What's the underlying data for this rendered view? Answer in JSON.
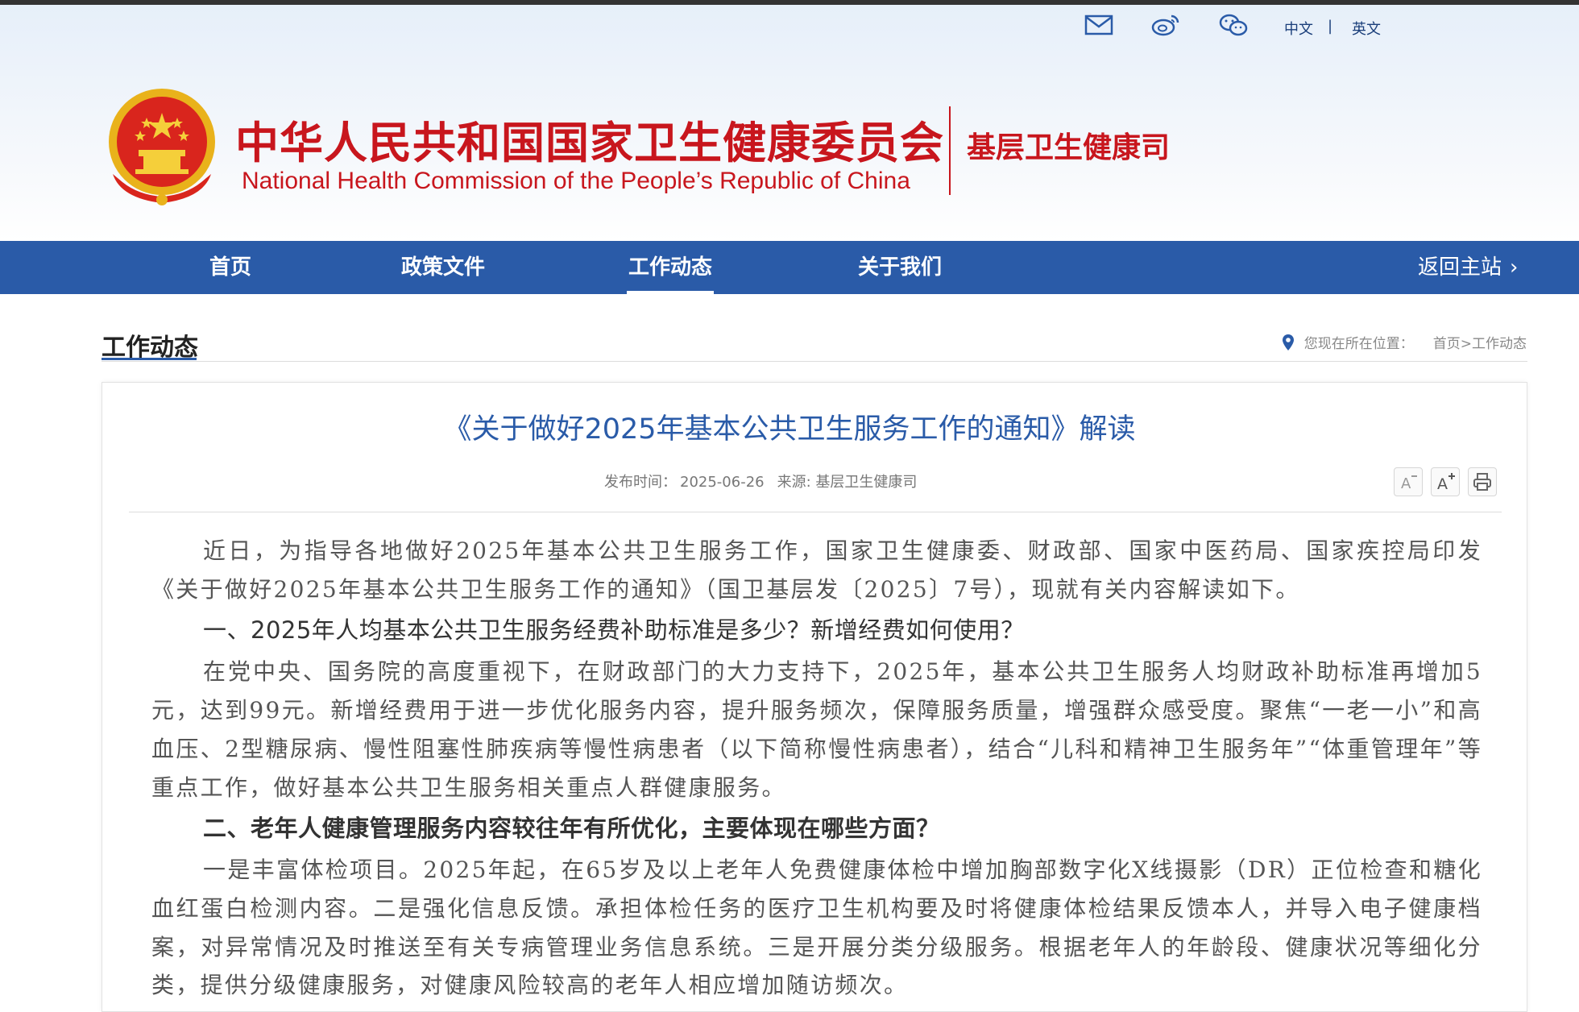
{
  "header": {
    "util_icons": [
      "mail-icon",
      "weibo-icon",
      "wechat-icon"
    ],
    "lang_cn": "中文",
    "lang_sep": "|",
    "lang_en": "英文",
    "logo_cn": "中华人民共和国国家卫生健康委员会",
    "logo_en": "National Health Commission of the People’s  Republic of China",
    "department": "基层卫生健康司"
  },
  "nav": {
    "items": [
      "首页",
      "政策文件",
      "工作动态",
      "关于我们"
    ],
    "active": "工作动态",
    "back": "返回主站"
  },
  "section": {
    "title": "工作动态",
    "breadcrumb_label": "您现在所在位置：",
    "breadcrumb_path": "首页>工作动态"
  },
  "article": {
    "title": "《关于做好2025年基本公共卫生服务工作的通知》解读",
    "publish_label": "发布时间：",
    "publish_date": "2025-06-26",
    "source": "来源: 基层卫生健康司",
    "tools": [
      "font-decrease-icon",
      "font-increase-icon",
      "print-icon"
    ],
    "paragraphs": [
      "近日，为指导各地做好2025年基本公共卫生服务工作，国家卫生健康委、财政部、国家中医药局、国家疾控局印发《关于做好2025年基本公共卫生服务工作的通知》（国卫基层发〔2025〕7号），现就有关内容解读如下。",
      "一、2025年人均基本公共卫生服务经费补助标准是多少？新增经费如何使用？",
      "在党中央、国务院的高度重视下，在财政部门的大力支持下，2025年，基本公共卫生服务人均财政补助标准再增加5元，达到99元。新增经费用于进一步优化服务内容，提升服务频次，保障服务质量，增强群众感受度。聚焦“一老一小”和高血压、2型糖尿病、慢性阻塞性肺疾病等慢性病患者（以下简称慢性病患者），结合“儿科和精神卫生服务年”“体重管理年”等重点工作，做好基本公共卫生服务相关重点人群健康服务。",
      "二、老年人健康管理服务内容较往年有所优化，主要体现在哪些方面？",
      "一是丰富体检项目。2025年起，在65岁及以上老年人免费健康体检中增加胸部数字化X线摄影（DR）正位检查和糖化血红蛋白检测内容。二是强化信息反馈。承担体检任务的医疗卫生机构要及时将健康体检结果反馈本人，并导入电子健康档案，对异常情况及时推送至有关专病管理业务信息系统。三是开展分类分级服务。根据老年人的年龄段、健康状况等细化分类，提供分级健康服务，对健康风险较高的老年人相应增加随访频次。"
    ]
  },
  "colors": {
    "brand_red": "#c8161d",
    "nav_blue": "#2a5ba8",
    "title_blue": "#2a5ba8"
  }
}
